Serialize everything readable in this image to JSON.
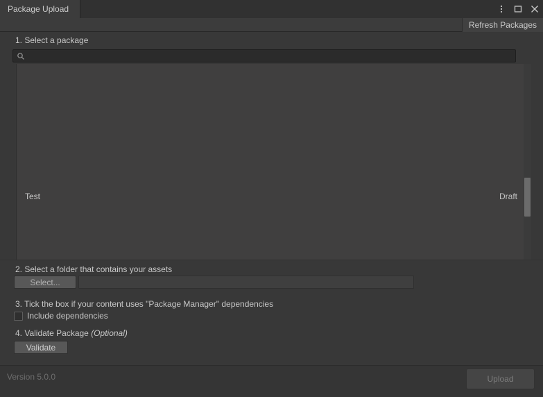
{
  "window": {
    "tab_title": "Package Upload",
    "accent_color": "#2c5d87",
    "controls": [
      {
        "name": "kebab-menu-icon",
        "label": "⋮"
      },
      {
        "name": "maximize-icon",
        "label": "□"
      },
      {
        "name": "close-icon",
        "label": "✕"
      }
    ]
  },
  "toolbar": {
    "refresh_label": "Refresh Packages"
  },
  "sections": {
    "one": {
      "label": "1. Select a package",
      "search": {
        "value": "",
        "placeholder": "",
        "icon": "search-icon"
      },
      "packages": [
        {
          "name": "Test",
          "status": "Draft"
        }
      ]
    },
    "two": {
      "label": "2. Select a folder that contains your assets",
      "select_button": "Select...",
      "folder_value": "",
      "folder_placeholder": ""
    },
    "three": {
      "label": "3. Tick the box if your content uses \"Package Manager\" dependencies",
      "checkbox_label": "Include dependencies",
      "checked": false
    },
    "four": {
      "label": "4. Validate Package ",
      "optional": "(Optional)",
      "validate_button": "Validate"
    }
  },
  "footer": {
    "version": "Version 5.0.0",
    "upload_label": "Upload",
    "upload_enabled": false
  }
}
